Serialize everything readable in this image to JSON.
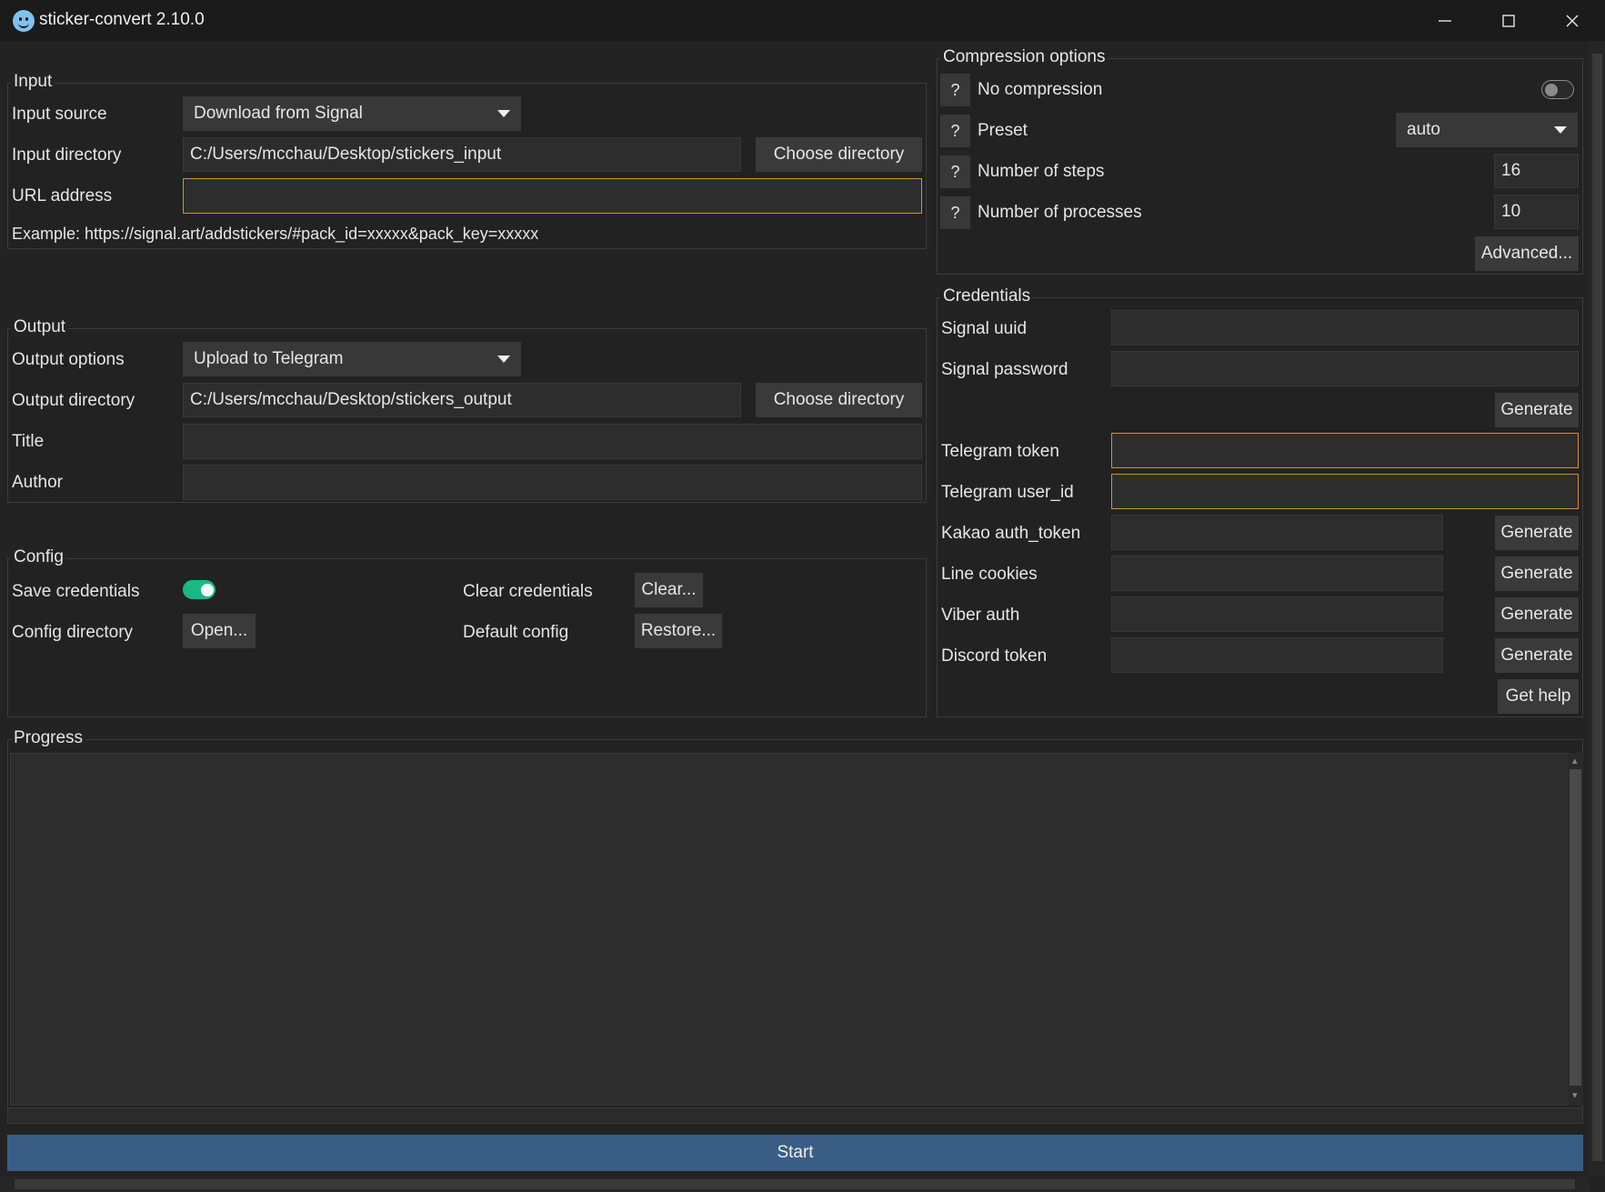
{
  "window": {
    "title": "sticker-convert 2.10.0",
    "minimize_glyph": "—",
    "maximize_glyph": "☐",
    "close_glyph": "✕"
  },
  "input": {
    "legend": "Input",
    "source_label": "Input source",
    "source_value": "Download from Signal",
    "directory_label": "Input directory",
    "directory_value": "C:/Users/mcchau/Desktop/stickers_input",
    "choose_directory": "Choose directory",
    "url_label": "URL address",
    "url_value": "",
    "example": "Example: https://signal.art/addstickers/#pack_id=xxxxx&pack_key=xxxxx"
  },
  "output": {
    "legend": "Output",
    "options_label": "Output options",
    "options_value": "Upload to Telegram",
    "directory_label": "Output directory",
    "directory_value": "C:/Users/mcchau/Desktop/stickers_output",
    "choose_directory": "Choose directory",
    "title_label": "Title",
    "title_value": "",
    "author_label": "Author",
    "author_value": ""
  },
  "config": {
    "legend": "Config",
    "save_credentials_label": "Save credentials",
    "save_credentials_on": true,
    "config_directory_label": "Config directory",
    "open_button": "Open...",
    "clear_credentials_label": "Clear credentials",
    "clear_button": "Clear...",
    "default_config_label": "Default config",
    "restore_button": "Restore..."
  },
  "compression": {
    "legend": "Compression options",
    "help_glyph": "?",
    "no_compression_label": "No compression",
    "no_compression_on": false,
    "preset_label": "Preset",
    "preset_value": "auto",
    "steps_label": "Number of steps",
    "steps_value": "16",
    "processes_label": "Number of processes",
    "processes_value": "10",
    "advanced_button": "Advanced..."
  },
  "credentials": {
    "legend": "Credentials",
    "signal_uuid_label": "Signal uuid",
    "signal_password_label": "Signal password",
    "generate_label": "Generate",
    "telegram_token_label": "Telegram token",
    "telegram_userid_label": "Telegram user_id",
    "kakao_label": "Kakao auth_token",
    "line_label": "Line cookies",
    "viber_label": "Viber auth",
    "discord_label": "Discord token",
    "get_help": "Get help"
  },
  "progress": {
    "legend": "Progress",
    "log": "",
    "scroll_up_glyph": "▴",
    "scroll_down_glyph": "▾"
  },
  "start_label": "Start",
  "colors": {
    "accent_warning": "#d4922a",
    "toggle_on": "#1bb886",
    "start_bg": "#3a5d86",
    "window_bg": "#232323",
    "field_bg": "#2d2d2d"
  }
}
